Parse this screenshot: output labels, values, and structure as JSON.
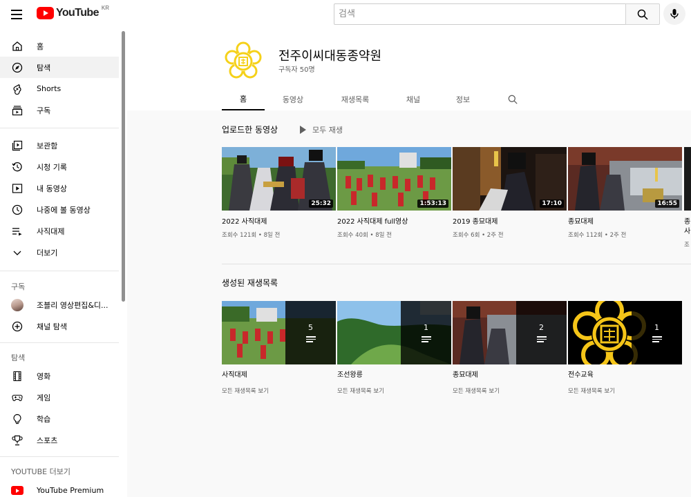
{
  "header": {
    "logo_text": "YouTube",
    "region": "KR",
    "search_placeholder": "검색"
  },
  "sidebar": {
    "main": [
      {
        "label": "홈",
        "icon": "home-icon"
      },
      {
        "label": "탐색",
        "icon": "compass-icon",
        "active": true
      },
      {
        "label": "Shorts",
        "icon": "shorts-icon"
      },
      {
        "label": "구독",
        "icon": "subscriptions-icon"
      }
    ],
    "library": [
      {
        "label": "보관함",
        "icon": "library-icon"
      },
      {
        "label": "시청 기록",
        "icon": "history-icon"
      },
      {
        "label": "내 동영상",
        "icon": "my-videos-icon"
      },
      {
        "label": "나중에 볼 동영상",
        "icon": "watch-later-icon"
      },
      {
        "label": "사직대제",
        "icon": "playlist-icon"
      },
      {
        "label": "더보기",
        "icon": "chevron-down-icon"
      }
    ],
    "subscriptions_title": "구독",
    "subscriptions": [
      {
        "label": "조블리 영상편집&디...",
        "icon": "avatar"
      },
      {
        "label": "채널 탐색",
        "icon": "add-circle-icon"
      }
    ],
    "explore_title": "탐색",
    "explore": [
      {
        "label": "영화",
        "icon": "film-icon"
      },
      {
        "label": "게임",
        "icon": "gamepad-icon"
      },
      {
        "label": "학습",
        "icon": "lightbulb-icon"
      },
      {
        "label": "스포츠",
        "icon": "trophy-icon"
      }
    ],
    "more_title": "YOUTUBE 더보기",
    "more": [
      {
        "label": "YouTube Premium",
        "icon": "youtube-logo-icon"
      }
    ]
  },
  "channel": {
    "name": "전주이씨대동종약원",
    "subscribers": "구독자 50명",
    "tabs": [
      "홈",
      "동영상",
      "재생목록",
      "채널",
      "정보"
    ]
  },
  "uploads": {
    "title": "업로드한 동영상",
    "play_all": "모두 재생",
    "videos": [
      {
        "title": "2022 사직대제",
        "meta": "조회수 121회 • 8일 전",
        "duration": "25:32"
      },
      {
        "title": "2022 사직대제 full영상",
        "meta": "조회수 40회 • 8일 전",
        "duration": "1:53:13"
      },
      {
        "title": "2019 종묘대제",
        "meta": "조회수 6회 • 2주 전",
        "duration": "17:10"
      },
      {
        "title": "종묘대제",
        "meta": "조회수 112회 • 2주 전",
        "duration": "16:55"
      },
      {
        "title": "종",
        "title2": "사",
        "meta": "조"
      }
    ]
  },
  "playlists": {
    "title": "생성된 재생목록",
    "items": [
      {
        "title": "사직대제",
        "count": "5",
        "link": "모든 재생목록 보기"
      },
      {
        "title": "조선왕릉",
        "count": "1",
        "link": "모든 재생목록 보기"
      },
      {
        "title": "종묘대제",
        "count": "2",
        "link": "모든 재생목록 보기"
      },
      {
        "title": "전수교육",
        "count": "1",
        "link": "모든 재생목록 보기"
      }
    ]
  },
  "colors": {
    "brand_red": "#ff0000",
    "emblem_yellow": "#f5d11a"
  }
}
